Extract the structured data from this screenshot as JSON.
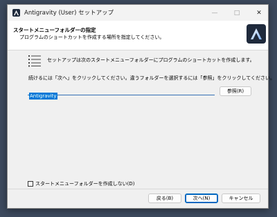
{
  "window": {
    "title": "Antigravity (User) セットアップ",
    "controls": {
      "minimize": "—",
      "maximize": "□",
      "close": "✕"
    }
  },
  "header": {
    "title": "スタートメニューフォルダーの指定",
    "subtitle": "プログラムのショートカットを作成する場所を指定してください。",
    "logo_icon": "antigravity-logo-icon"
  },
  "body": {
    "info_text": "セットアップは次のスタートメニューフォルダーにプログラムのショートカットを作成します。",
    "continue_text": "続けるには「次へ」をクリックしてください。違うフォルダーを選択するには「参照」をクリックしてください。",
    "folder_value": "Antigravity",
    "browse_label": "参照(R)",
    "no_folder_label": "スタートメニューフォルダーを作成しない(D)",
    "no_folder_checked": false
  },
  "footer": {
    "back_label": "戻る(B)",
    "next_label": "次へ(N)",
    "cancel_label": "キャンセル"
  },
  "colors": {
    "accent": "#0078d7",
    "logo_bg": "#1f2a3c",
    "window_bg": "#f0f0f0"
  }
}
